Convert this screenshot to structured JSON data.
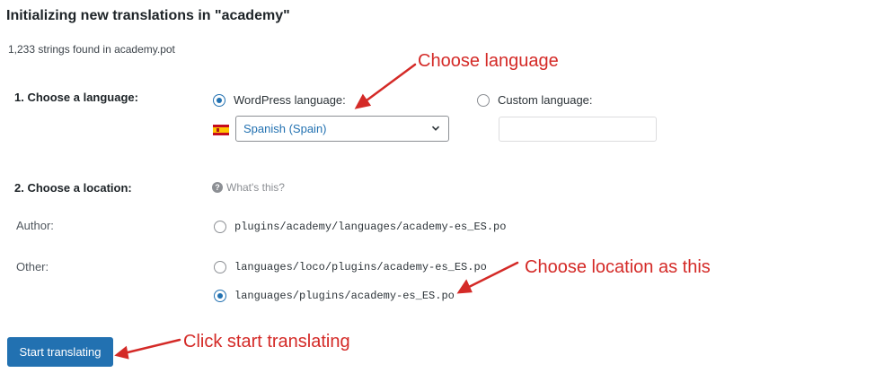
{
  "header": {
    "title": "Initializing new translations in \"academy\"",
    "strings_found": "1,233 strings found in academy.pot"
  },
  "language_section": {
    "label": "1. Choose a language:",
    "wp_language_label": "WordPress language:",
    "selected_language": "Spanish (Spain)",
    "custom_language_label": "Custom language:",
    "custom_language_value": ""
  },
  "location_section": {
    "label": "2. Choose a location:",
    "help_text": "What's this?",
    "author_label": "Author:",
    "author_path": "plugins/academy/languages/academy-es_ES.po",
    "other_label": "Other:",
    "other_paths": [
      "languages/loco/plugins/academy-es_ES.po",
      "languages/plugins/academy-es_ES.po"
    ]
  },
  "actions": {
    "start_label": "Start translating"
  },
  "annotations": {
    "choose_language": "Choose language",
    "choose_location": "Choose location as this",
    "click_start": "Click start translating",
    "color": "#d42a27"
  },
  "colors": {
    "accent": "#2271b1"
  },
  "icons": {
    "help": "question-circle-icon",
    "flag": "spain-flag-icon",
    "dropdown": "chevron-down-icon"
  }
}
